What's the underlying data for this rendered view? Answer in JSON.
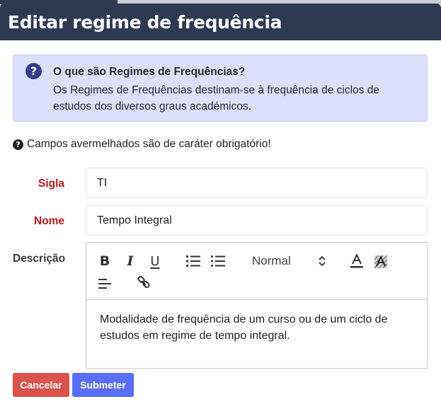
{
  "modal": {
    "title": "Editar regime de frequência"
  },
  "info": {
    "icon": "question-circle-icon",
    "title": "O que são Regimes de Frequências?",
    "text": "Os Regimes de Frequências destinam-se à frequência de ciclos de estudos dos diversos graus académicos."
  },
  "form": {
    "required_note": "Campos avermelhados são de caráter obrigatório!",
    "sigla": {
      "label": "Sigla",
      "value": "TI"
    },
    "nome": {
      "label": "Nome",
      "value": "Tempo Integral"
    },
    "descricao": {
      "label": "Descrição",
      "toolbar": {
        "bold": "B",
        "italic": "I",
        "underline": "U",
        "header_select": "Normal"
      },
      "content": "Modalidade de frequência de um curso ou de um ciclo de estudos em regime de tempo integral."
    }
  },
  "buttons": {
    "cancel": "Cancelar",
    "submit": "Submeter"
  },
  "colors": {
    "header": "#2f3a52",
    "info_bg": "#dde0fd",
    "required": "#c0161b",
    "cancel": "#d9534f",
    "submit": "#5a6ef8"
  }
}
